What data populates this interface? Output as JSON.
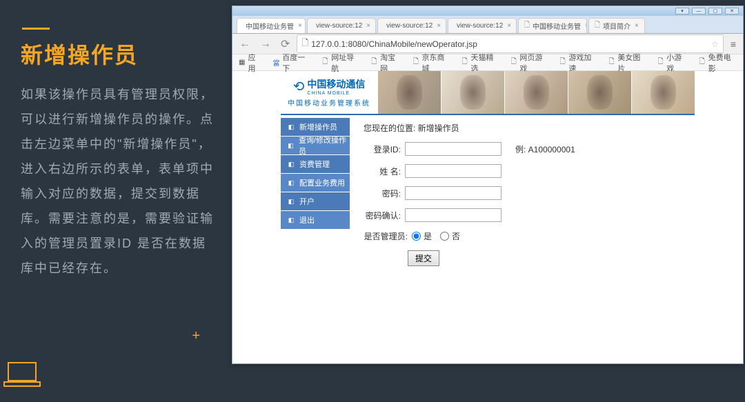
{
  "slide": {
    "title": "新增操作员",
    "description": "如果该操作员具有管理员权限，可以进行新增操作员的操作。点击左边菜单中的\"新增操作员\"，进入右边所示的表单，表单项中输入对应的数据，提交到数据库。需要注意的是，需要验证输入的管理员置录ID 是否在数据库中已经存在。"
  },
  "browser": {
    "tabs": [
      {
        "label": "中国移动业务管",
        "icon_color": "#ff8c00"
      },
      {
        "label": "view-source:12",
        "icon_color": "#ff8c00"
      },
      {
        "label": "view-source:12",
        "icon_color": "#ff8c00"
      },
      {
        "label": "view-source:12",
        "icon_color": "#ff8c00"
      },
      {
        "label": "中国移动业务管",
        "icon_color": "#888"
      },
      {
        "label": "项目简介",
        "icon_color": "#888"
      }
    ],
    "url": "127.0.0.1:8080/ChinaMobile/newOperator.jsp",
    "bookmarks": [
      "应用",
      "百度一下",
      "网址导航",
      "淘宝网",
      "京东商城",
      "天猫精选",
      "网页游戏",
      "游戏加速",
      "美女图片",
      "小游戏",
      "免费电影"
    ]
  },
  "page": {
    "logo": {
      "main": "中国移动通信",
      "sub": "CHINA MOBILE",
      "system": "中国移动业务管理系统"
    },
    "menu": [
      "新增操作员",
      "查询/修改操作员",
      "资费管理",
      "配置业务费用",
      "开户",
      "退出"
    ],
    "breadcrumb": "您现在的位置: 新增操作员",
    "form": {
      "login_id_label": "登录ID:",
      "login_id_hint": "例: A100000001",
      "name_label": "姓 名:",
      "password_label": "密码:",
      "password_confirm_label": "密码确认:",
      "is_admin_label": "是否管理员:",
      "radio_yes": "是",
      "radio_no": "否",
      "submit": "提交"
    }
  }
}
